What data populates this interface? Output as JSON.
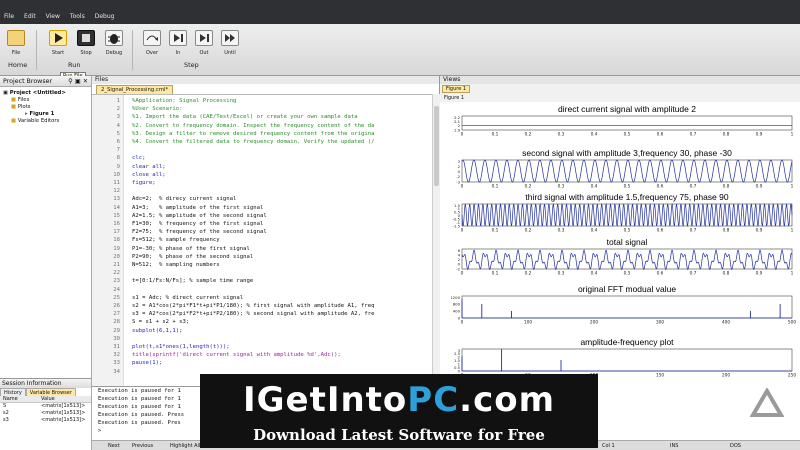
{
  "menu": [
    "File",
    "Edit",
    "View",
    "Tools",
    "Debug"
  ],
  "ribbon": {
    "home": {
      "group": "Home",
      "buttons": [
        "File"
      ]
    },
    "run": {
      "group": "Run",
      "buttons": [
        "Start",
        "Stop",
        "Debug"
      ],
      "tooltip": "Run File"
    },
    "step": {
      "group": "Step",
      "buttons": [
        "Over",
        "In",
        "Out",
        "Until"
      ]
    }
  },
  "project_browser": {
    "title": "Project Browser",
    "tree": [
      "Project <Untitled>",
      "Files",
      "Plots",
      "Figure 1",
      "Variable Editors"
    ]
  },
  "files_panel": {
    "title": "Files",
    "tab": "2_Signal_Processing.cml*"
  },
  "code": [
    {
      "n": "1",
      "t": "%Application: Signal Processing",
      "k": "cm"
    },
    {
      "n": "2",
      "t": "%User Scenario:",
      "k": "cm"
    },
    {
      "n": "3",
      "t": "%1. Import the data (CAE/Test/Excel) or create your own sample data",
      "k": "cm"
    },
    {
      "n": "4",
      "t": "%2. Convert to frequency domain. Inspect the frequency content of the da",
      "k": "cm"
    },
    {
      "n": "5",
      "t": "%3. Design a filter to remove desired frequency content from the origina",
      "k": "cm"
    },
    {
      "n": "6",
      "t": "%4. Convert the filtered data to frequency domain. Verify the updated (/",
      "k": "cm"
    },
    {
      "n": "7",
      "t": "",
      "k": ""
    },
    {
      "n": "8",
      "t": "clc;",
      "k": "kw"
    },
    {
      "n": "9",
      "t": "clear all;",
      "k": "kw"
    },
    {
      "n": "10",
      "t": "close all;",
      "k": "kw"
    },
    {
      "n": "11",
      "t": "figure;",
      "k": "kw"
    },
    {
      "n": "12",
      "t": "",
      "k": ""
    },
    {
      "n": "13",
      "t": "Adc=2;  % direcy current signal",
      "k": "mix"
    },
    {
      "n": "14",
      "t": "A1=3;   % amplitude of the first signal",
      "k": "mix"
    },
    {
      "n": "15",
      "t": "A2=1.5; % amplitude of the second signal",
      "k": "mix"
    },
    {
      "n": "16",
      "t": "F1=30;  % frequency of the first signal",
      "k": "mix"
    },
    {
      "n": "17",
      "t": "F2=75;  % frequency of the second signal",
      "k": "mix"
    },
    {
      "n": "18",
      "t": "Fs=512; % sample frequency",
      "k": "mix"
    },
    {
      "n": "19",
      "t": "P1=-30; % phase of the first signal",
      "k": "mix"
    },
    {
      "n": "20",
      "t": "P2=90;  % phase of the second signal",
      "k": "mix"
    },
    {
      "n": "21",
      "t": "N=512;  % sampling numbers",
      "k": "mix"
    },
    {
      "n": "22",
      "t": "",
      "k": ""
    },
    {
      "n": "23",
      "t": "t=[0:1/Fs:N/Fs]; % sample time range",
      "k": "mix"
    },
    {
      "n": "24",
      "t": "",
      "k": ""
    },
    {
      "n": "25",
      "t": "s1 = Adc; % direct current signal",
      "k": "mix"
    },
    {
      "n": "26",
      "t": "s2 = A1*cos(2*pi*F1*t+pi*P1/180); % first signal with amplitude A1, freq",
      "k": "mix"
    },
    {
      "n": "27",
      "t": "s3 = A2*cos(2*pi*F2*t+pi*P2/180); % second signal with amplitude A2, fre",
      "k": "mix"
    },
    {
      "n": "28",
      "t": "S = s1 + s2 + s3;",
      "k": ""
    },
    {
      "n": "29",
      "t": "subplot(6,1,1);",
      "k": "kw"
    },
    {
      "n": "30",
      "t": "",
      "k": ""
    },
    {
      "n": "31",
      "t": "plot(t,s1*ones(1,length(t)));",
      "k": "kw"
    },
    {
      "n": "32",
      "t": "title(sprintf('direct current signal with amplitude %d',Adc));",
      "k": "st"
    },
    {
      "n": "33",
      "t": "pause(1);",
      "k": "kw"
    },
    {
      "n": "34",
      "t": "",
      "k": ""
    }
  ],
  "console": [
    "Execution is paused for 1",
    "Execution is paused for 1",
    "Execution is paused for 1",
    "Execution is paused. Press",
    "Execution is paused. Pres",
    ">"
  ],
  "session": {
    "title": "Session Information",
    "tabs": [
      "History",
      "Variable Browser"
    ],
    "columns": [
      "Name",
      "Value"
    ],
    "vars": [
      {
        "name": "S",
        "value": "<matrix[1x513]>"
      },
      {
        "name": "s2",
        "value": "<matrix[1x513]>"
      },
      {
        "name": "s3",
        "value": "<matrix[1x513]>"
      }
    ]
  },
  "statusbar": {
    "left": "Next",
    "prev": "Previous",
    "highlight": "Highlight All",
    "col": "Col 1",
    "ins": "INS",
    "dos": "DOS"
  },
  "views": {
    "title": "Views",
    "tab": "Figure 1",
    "figure_label": "Figure 1"
  },
  "chart_data": [
    {
      "type": "line",
      "title": "direct current signal with amplitude 2",
      "xlim": [
        0,
        1
      ],
      "ylim": [
        1.9,
        2.2
      ],
      "yticks": [
        "2.2",
        "2.1",
        "2",
        "1.9"
      ],
      "xticks": [
        "0",
        "0.1",
        "0.2",
        "0.3",
        "0.4",
        "0.5",
        "0.6",
        "0.7",
        "0.8",
        "0.9",
        "1"
      ],
      "signal": {
        "kind": "constant",
        "value": 2
      }
    },
    {
      "type": "line",
      "title": "second signal with amplitude 3,frequency 30, phase -30",
      "xlim": [
        0,
        1
      ],
      "ylim": [
        -3,
        3
      ],
      "yticks": [
        "3",
        "2",
        "0",
        "-2",
        "-3"
      ],
      "xticks": [
        "0",
        "0.1",
        "0.2",
        "0.3",
        "0.4",
        "0.5",
        "0.6",
        "0.7",
        "0.8",
        "0.9",
        "1"
      ],
      "signal": {
        "kind": "cos",
        "amplitude": 3,
        "frequency": 30,
        "phase": -30
      }
    },
    {
      "type": "line",
      "title": "third signal with amplitude 1.5,frequency 75, phase 90",
      "xlim": [
        0,
        1
      ],
      "ylim": [
        -1.5,
        1.5
      ],
      "yticks": [
        "1.5",
        "1",
        "0.5",
        "0",
        "-0.5",
        "-1",
        "-1.5"
      ],
      "xticks": [
        "0",
        "0.1",
        "0.2",
        "0.3",
        "0.4",
        "0.5",
        "0.6",
        "0.7",
        "0.8",
        "0.9",
        "1"
      ],
      "signal": {
        "kind": "cos",
        "amplitude": 1.5,
        "frequency": 75,
        "phase": 90
      }
    },
    {
      "type": "line",
      "title": "total signal",
      "xlim": [
        0,
        1
      ],
      "ylim": [
        -2,
        7
      ],
      "yticks": [
        "6",
        "4",
        "2",
        "0",
        "-2"
      ],
      "xticks": [
        "0",
        "0.1",
        "0.2",
        "0.3",
        "0.4",
        "0.5",
        "0.6",
        "0.7",
        "0.8",
        "0.9",
        "1"
      ],
      "signal": {
        "kind": "sum"
      }
    },
    {
      "type": "line",
      "title": "original FFT modual value",
      "xlim": [
        0,
        500
      ],
      "ylim": [
        0,
        1200
      ],
      "yticks": [
        "1200",
        "800",
        "400",
        "0"
      ],
      "xticks": [
        "0",
        "100",
        "200",
        "300",
        "400",
        "500"
      ],
      "peaks": [
        {
          "x": 0,
          "y": 1024
        },
        {
          "x": 30,
          "y": 768
        },
        {
          "x": 75,
          "y": 384
        },
        {
          "x": 437,
          "y": 384
        },
        {
          "x": 482,
          "y": 768
        }
      ]
    },
    {
      "type": "line",
      "title": "amplitude-frequency plot",
      "xlim": [
        0,
        250
      ],
      "ylim": [
        0,
        3
      ],
      "yticks": [
        "3",
        "2.5",
        "2",
        "1.5",
        "1",
        "0.5",
        "0"
      ],
      "xticks": [
        "0",
        "50",
        "100",
        "150",
        "200",
        "250"
      ],
      "peaks": [
        {
          "x": 0,
          "y": 2
        },
        {
          "x": 30,
          "y": 3
        },
        {
          "x": 75,
          "y": 1.5
        }
      ]
    }
  ],
  "watermark": {
    "main_a": "IGetInto",
    "main_b": "PC",
    "main_c": ".com",
    "sub": "Download Latest Software for Free"
  }
}
